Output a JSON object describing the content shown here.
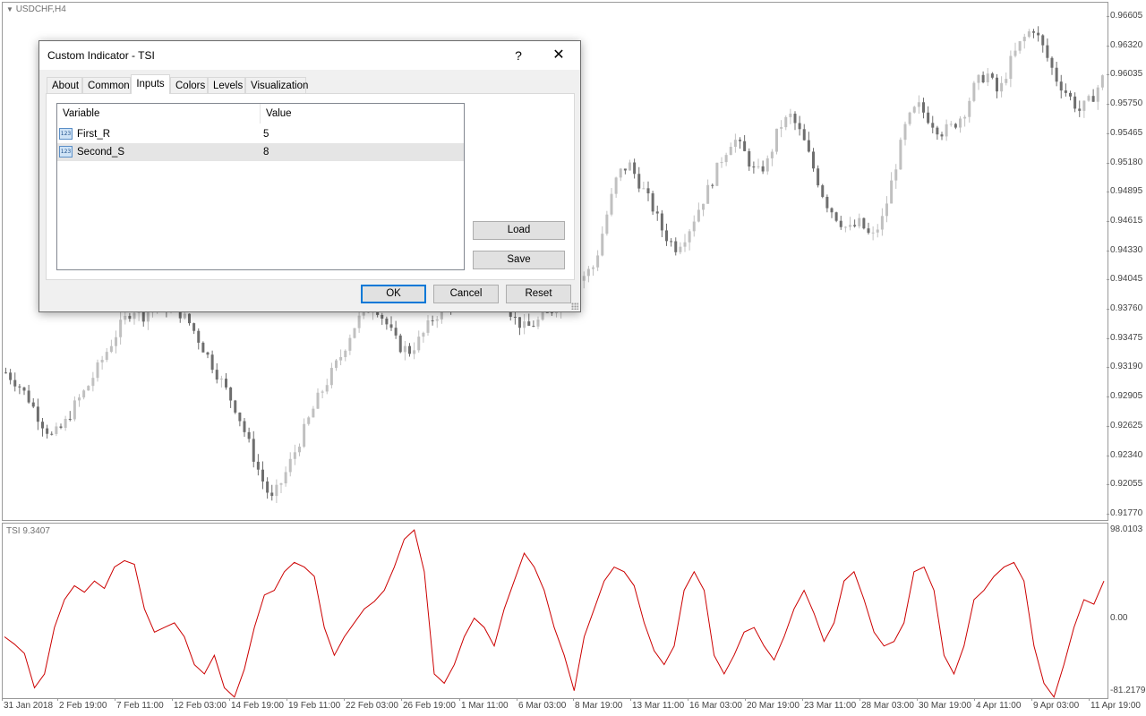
{
  "chart": {
    "symbol_label": "USDCHF,H4",
    "price_axis": [
      "0.96605",
      "0.96320",
      "0.96035",
      "0.95750",
      "0.95465",
      "0.95180",
      "0.94895",
      "0.94615",
      "0.94330",
      "0.94045",
      "0.93760",
      "0.93475",
      "0.93190",
      "0.92905",
      "0.92625",
      "0.92340",
      "0.92055",
      "0.91770"
    ],
    "date_axis": [
      "31 Jan 2018",
      "2 Feb 19:00",
      "7 Feb 11:00",
      "12 Feb 03:00",
      "14 Feb 19:00",
      "19 Feb 11:00",
      "22 Feb 03:00",
      "26 Feb 19:00",
      "1 Mar 11:00",
      "6 Mar 03:00",
      "8 Mar 19:00",
      "13 Mar 11:00",
      "16 Mar 03:00",
      "20 Mar 19:00",
      "23 Mar 11:00",
      "28 Mar 03:00",
      "30 Mar 19:00",
      "4 Apr 11:00",
      "9 Apr 03:00",
      "11 Apr 19:00"
    ],
    "bull_color": "#c0c0c0",
    "bear_color": "#6e6e6e"
  },
  "indicator": {
    "label": "TSI 9.3407",
    "axis": [
      "98.0103",
      "0.00",
      "-81.2179"
    ],
    "line_color": "#cc0000"
  },
  "chart_data": [
    {
      "type": "candlestick",
      "title": "USDCHF,H4",
      "ylim": [
        0.9177,
        0.9661
      ],
      "close_trace": [
        0.9315,
        0.9305,
        0.929,
        0.927,
        0.9255,
        0.9265,
        0.9285,
        0.93,
        0.932,
        0.934,
        0.936,
        0.9375,
        0.9368,
        0.938,
        0.9376,
        0.9372,
        0.936,
        0.934,
        0.932,
        0.93,
        0.928,
        0.925,
        0.922,
        0.9195,
        0.9215,
        0.924,
        0.9265,
        0.929,
        0.931,
        0.933,
        0.9355,
        0.9372,
        0.9378,
        0.936,
        0.934,
        0.9335,
        0.9348,
        0.9366,
        0.9375,
        0.9385,
        0.9392,
        0.9402,
        0.9398,
        0.9388,
        0.9366,
        0.9356,
        0.9362,
        0.937,
        0.9382,
        0.9395,
        0.9405,
        0.9415,
        0.946,
        0.95,
        0.951,
        0.949,
        0.947,
        0.9445,
        0.9432,
        0.9445,
        0.9468,
        0.949,
        0.9515,
        0.9535,
        0.952,
        0.95,
        0.9512,
        0.9545,
        0.9555,
        0.9535,
        0.9505,
        0.9475,
        0.946,
        0.9448,
        0.9455,
        0.944,
        0.946,
        0.9505,
        0.9548,
        0.9565,
        0.9552,
        0.954,
        0.9545,
        0.9558,
        0.9585,
        0.9595,
        0.9575,
        0.9605,
        0.9625,
        0.9638,
        0.9615,
        0.959,
        0.9575,
        0.956,
        0.957,
        0.959
      ],
      "series": [
        {
          "name": "USDCHF,H4"
        }
      ]
    },
    {
      "type": "line",
      "title": "TSI 9.3407",
      "ylim": [
        -81.2179,
        98.0103
      ],
      "series": [
        {
          "name": "TSI 9.3407",
          "values": [
            -20,
            -28,
            -38,
            -75,
            -60,
            -10,
            20,
            35,
            28,
            40,
            32,
            55,
            62,
            58,
            10,
            -15,
            -10,
            -5,
            -20,
            -50,
            -60,
            -40,
            -75,
            -85,
            -55,
            -10,
            25,
            30,
            50,
            60,
            55,
            45,
            -10,
            -40,
            -20,
            -5,
            10,
            18,
            30,
            55,
            85,
            95,
            50,
            -60,
            -70,
            -50,
            -20,
            0,
            -10,
            -30,
            10,
            40,
            70,
            55,
            30,
            -10,
            -40,
            -78,
            -20,
            10,
            40,
            55,
            50,
            35,
            -5,
            -35,
            -50,
            -30,
            30,
            50,
            30,
            -40,
            -60,
            -40,
            -15,
            -10,
            -30,
            -45,
            -20,
            10,
            30,
            5,
            -25,
            -5,
            40,
            50,
            20,
            -15,
            -30,
            -25,
            -5,
            50,
            55,
            30,
            -40,
            -60,
            -30,
            20,
            30,
            45,
            55,
            60,
            40,
            -30,
            -70,
            -85,
            -50,
            -10,
            20,
            15,
            40
          ]
        }
      ]
    }
  ],
  "dialog": {
    "title": "Custom Indicator - TSI",
    "help_glyph": "?",
    "close_glyph": "✕",
    "tabs": [
      {
        "label": "About"
      },
      {
        "label": "Common"
      },
      {
        "label": "Inputs"
      },
      {
        "label": "Colors"
      },
      {
        "label": "Levels"
      },
      {
        "label": "Visualization"
      }
    ],
    "active_tab": "Inputs",
    "grid": {
      "col_variable": "Variable",
      "col_value": "Value",
      "icon_text": "123",
      "rows": [
        {
          "name": "First_R",
          "value": "5"
        },
        {
          "name": "Second_S",
          "value": "8"
        }
      ]
    },
    "buttons": {
      "load": "Load",
      "save": "Save",
      "ok": "OK",
      "cancel": "Cancel",
      "reset": "Reset"
    }
  }
}
